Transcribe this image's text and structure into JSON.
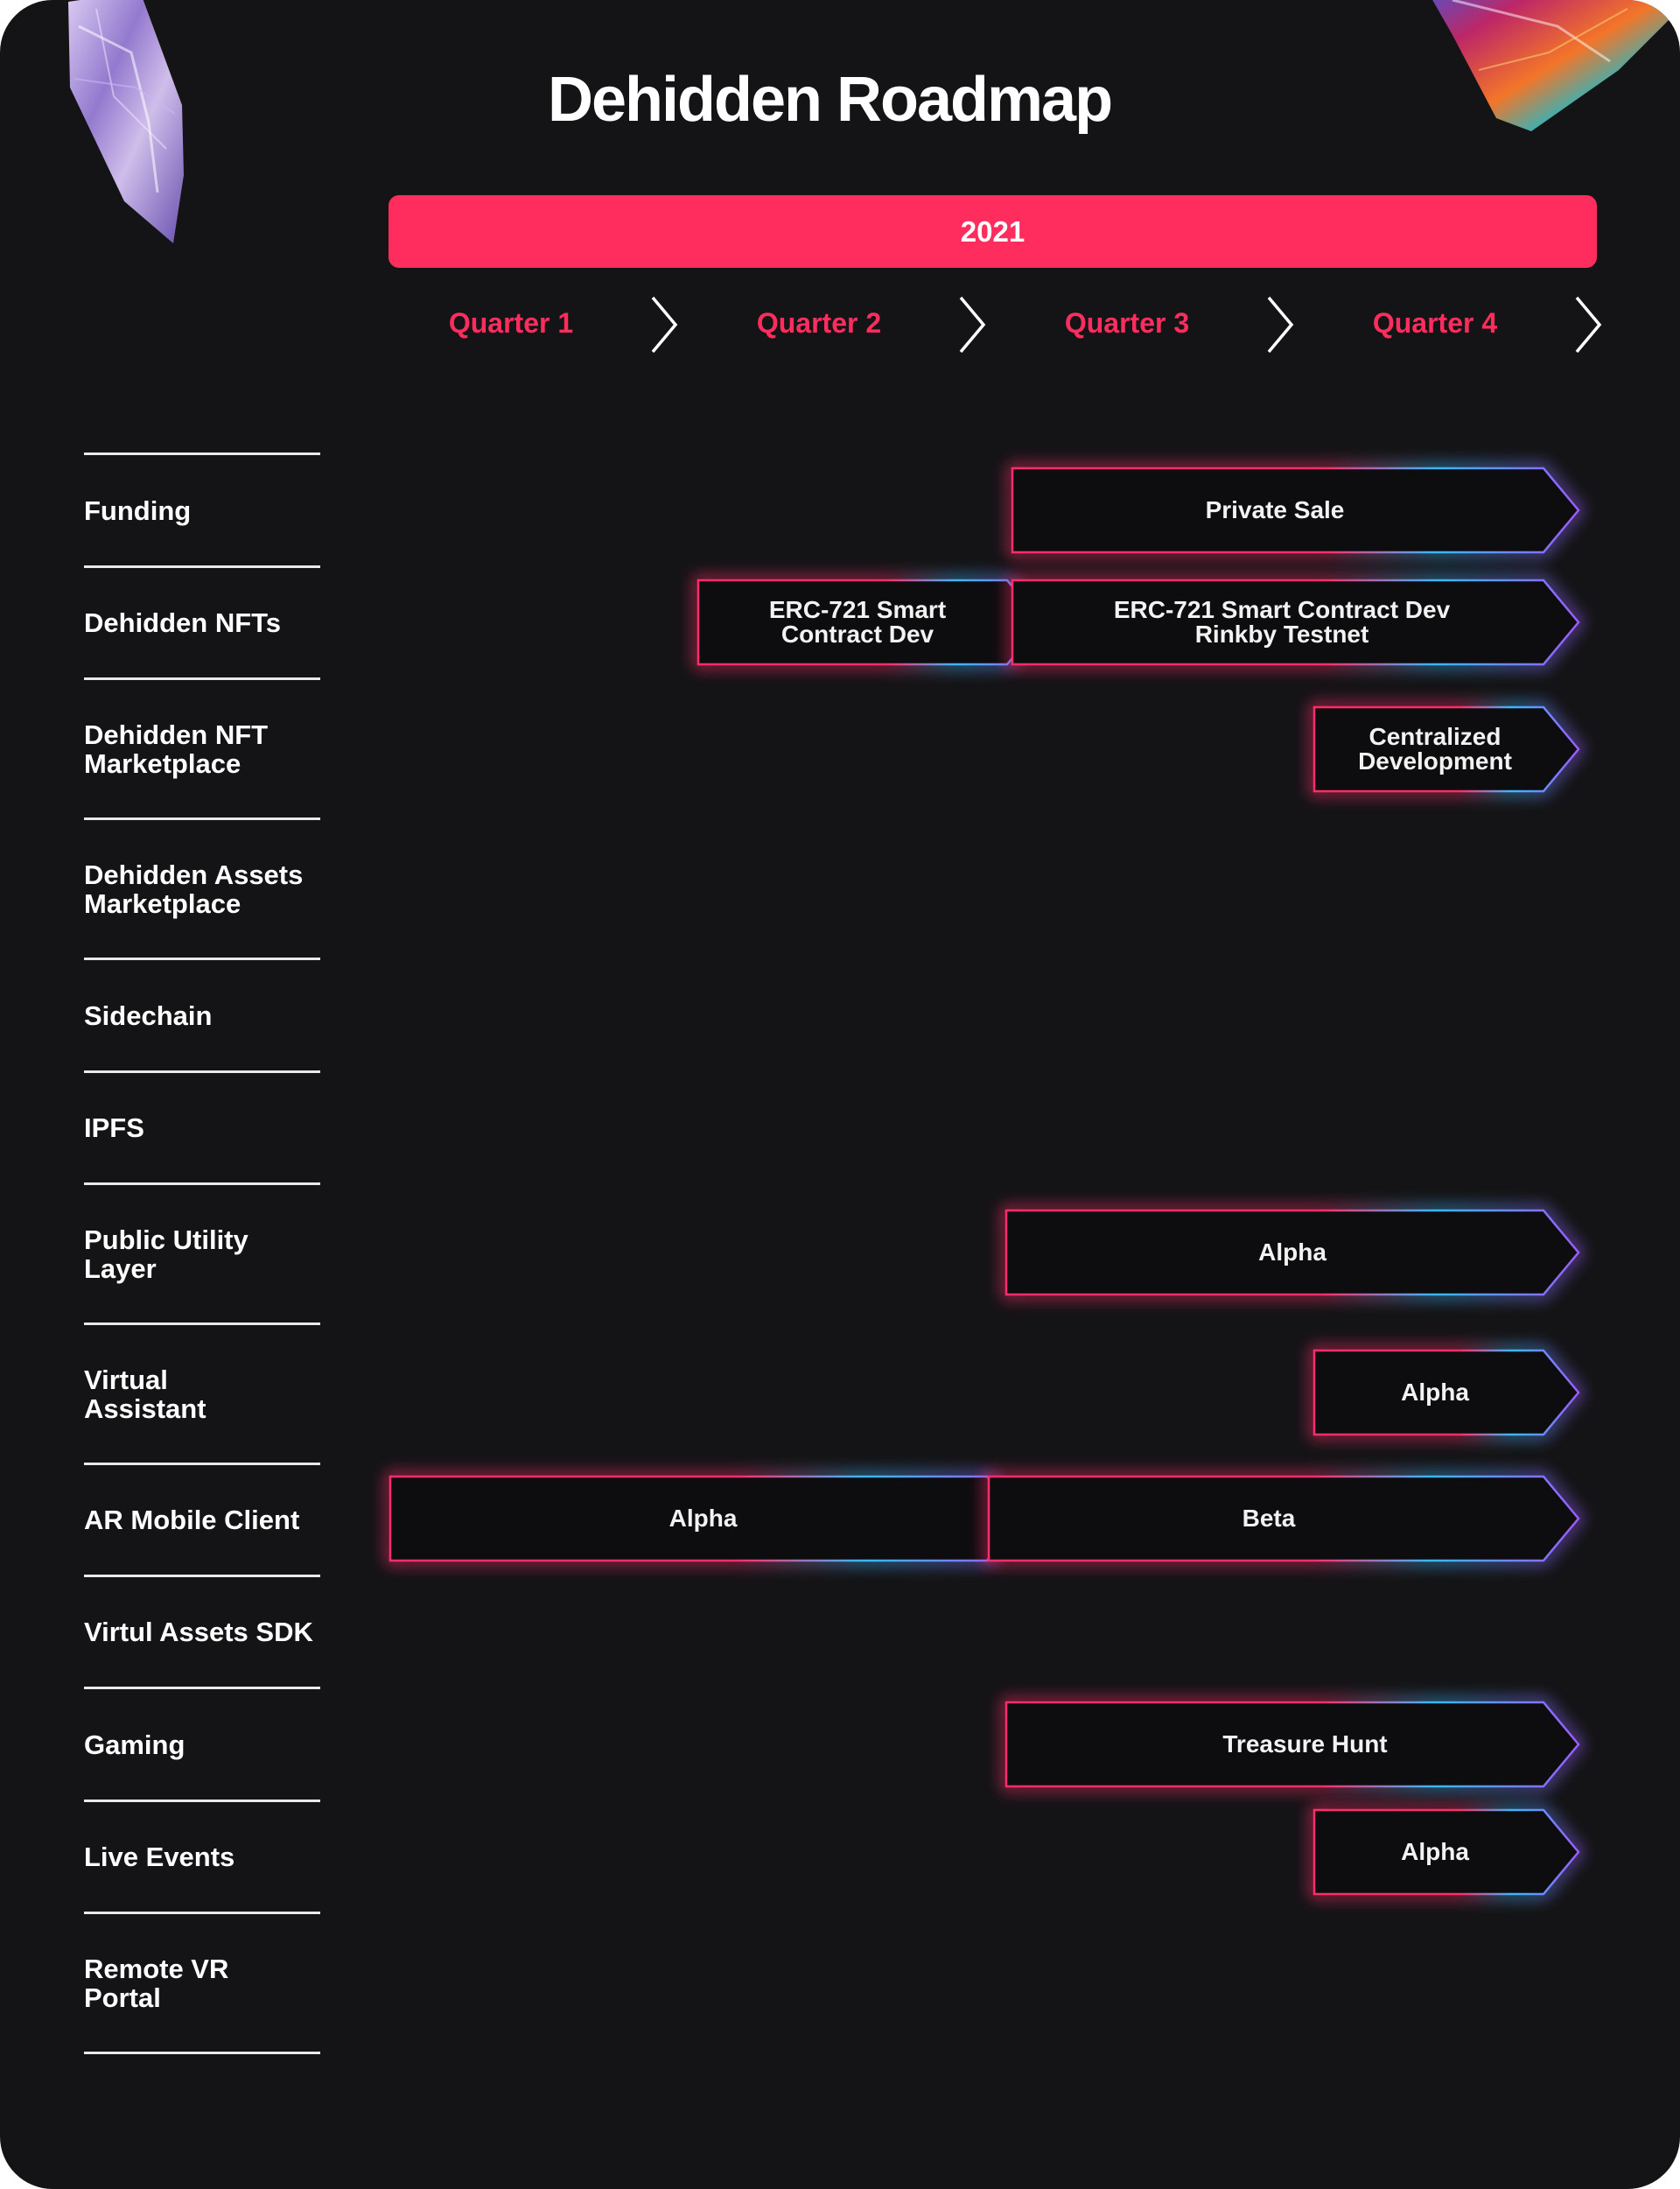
{
  "title": "Dehidden Roadmap",
  "year": "2021",
  "quarters": [
    "Quarter 1",
    "Quarter 2",
    "Quarter 3",
    "Quarter 4"
  ],
  "colors": {
    "background": "#141416",
    "accent": "#ff2d5e",
    "glow_pink": "#ff2d6a",
    "glow_blue": "#3ab8ff",
    "glow_purple": "#9a5cff",
    "bar_fill": "#0d0d0f"
  },
  "rows": [
    {
      "label": "Funding"
    },
    {
      "label": "Dehidden NFTs"
    },
    {
      "label": "Dehidden NFT Marketplace"
    },
    {
      "label": "Dehidden Assets Marketplace"
    },
    {
      "label": "Sidechain"
    },
    {
      "label": "IPFS"
    },
    {
      "label": "Public Utility Layer"
    },
    {
      "label": "Virtual Assistant"
    },
    {
      "label": "AR Mobile Client"
    },
    {
      "label": "Virtul Assets SDK"
    },
    {
      "label": "Gaming"
    },
    {
      "label": "Live Events"
    },
    {
      "label": "Remote VR Portal"
    }
  ],
  "milestones": [
    {
      "row": "Funding",
      "label": "Private Sale"
    },
    {
      "row": "Dehidden NFTs",
      "label": "ERC-721 Smart Contract Dev"
    },
    {
      "row": "Dehidden NFTs",
      "label": "ERC-721 Smart Contract Dev Rinkby Testnet"
    },
    {
      "row": "Dehidden NFT Marketplace",
      "label": "Centralized Development"
    },
    {
      "row": "Public Utility Layer",
      "label": "Alpha"
    },
    {
      "row": "Virtual Assistant",
      "label": "Alpha"
    },
    {
      "row": "AR Mobile Client",
      "label": "Alpha"
    },
    {
      "row": "AR Mobile Client",
      "label": "Beta"
    },
    {
      "row": "Gaming",
      "label": "Treasure Hunt"
    },
    {
      "row": "Live Events",
      "label": "Alpha"
    }
  ],
  "icons": {
    "quarter_separator": "chevron-right-icon",
    "decor_left": "crystal-shard-icon",
    "decor_right": "iridescent-gem-icon"
  }
}
